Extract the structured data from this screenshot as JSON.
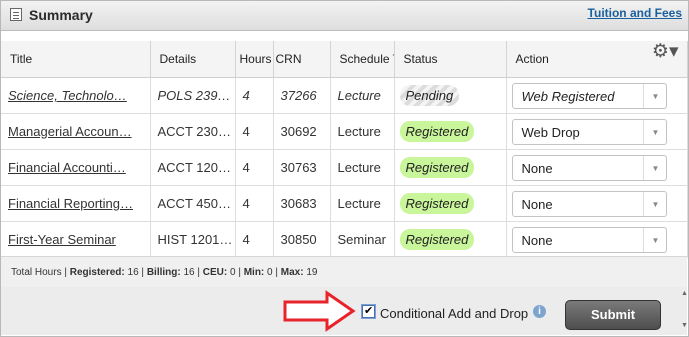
{
  "header": {
    "title": "Summary",
    "tuition_link": "Tuition and Fees"
  },
  "columns": [
    "Title",
    "Details",
    "Hours",
    "CRN",
    "Schedule T",
    "Status",
    "Action"
  ],
  "rows": [
    {
      "title": "Science, Technolo…",
      "details": "POLS 239…",
      "hours": "4",
      "crn": "37266",
      "schedule": "Lecture",
      "status": "Pending",
      "action": "Web Registered",
      "italic": true
    },
    {
      "title": "Managerial Accoun…",
      "details": "ACCT 230…",
      "hours": "4",
      "crn": "30692",
      "schedule": "Lecture",
      "status": "Registered",
      "action": "Web Drop",
      "italic": false
    },
    {
      "title": "Financial Accounti…",
      "details": "ACCT 120…",
      "hours": "4",
      "crn": "30763",
      "schedule": "Lecture",
      "status": "Registered",
      "action": "None",
      "italic": false
    },
    {
      "title": "Financial Reporting…",
      "details": "ACCT 450…",
      "hours": "4",
      "crn": "30683",
      "schedule": "Lecture",
      "status": "Registered",
      "action": "None",
      "italic": false
    },
    {
      "title": "First-Year Seminar",
      "details": "HIST 1201…",
      "hours": "4",
      "crn": "30850",
      "schedule": "Seminar",
      "status": "Registered",
      "action": "None",
      "italic": false
    }
  ],
  "totals": {
    "prefix": "Total Hours | ",
    "registered_label": "Registered:",
    "registered": "16",
    "billing_label": "Billing:",
    "billing": "16",
    "ceu_label": "CEU:",
    "ceu": "0",
    "min_label": "Min:",
    "min": "0",
    "max_label": "Max:",
    "max": "19"
  },
  "bottom": {
    "conditional_label": "Conditional Add and Drop",
    "conditional_checked": true,
    "submit_label": "Submit"
  },
  "icons": {
    "summary": "summary-icon",
    "settings": "gear-icon",
    "info": "info-icon",
    "pointer": "red-arrow-icon"
  },
  "colors": {
    "registered_badge": "#c9f59b",
    "link": "#1a5f9e",
    "arrow": "#e8232a"
  }
}
